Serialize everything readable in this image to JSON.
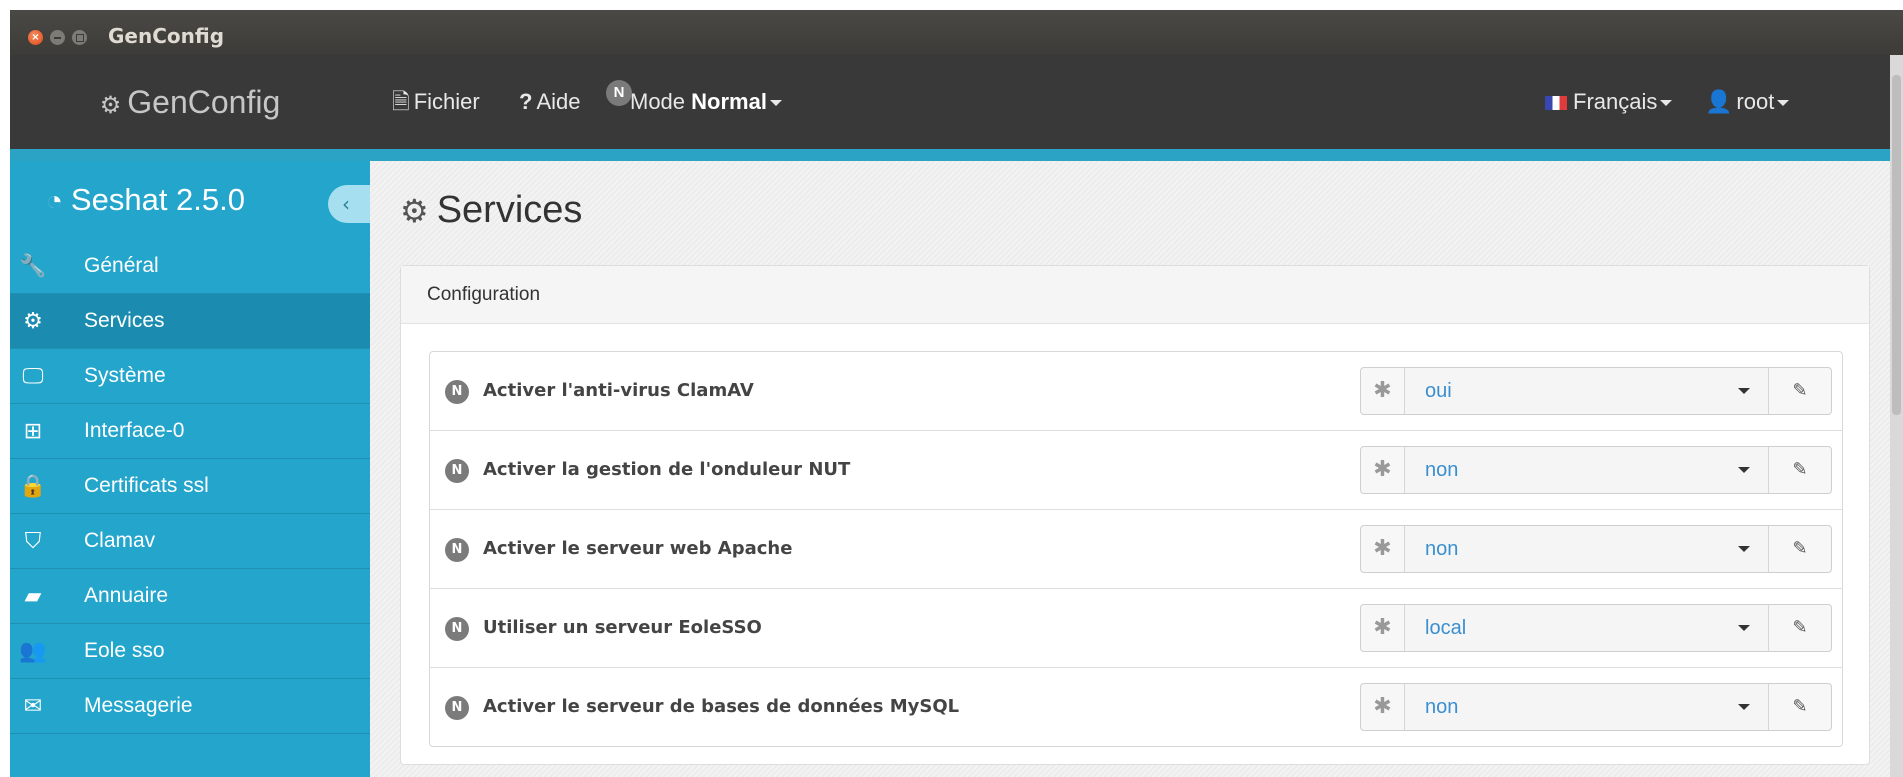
{
  "window": {
    "title": "GenConfig"
  },
  "navbar": {
    "brand": "GenConfig",
    "file_label": "Fichier",
    "help_label": "Aide",
    "mode_badge": "N",
    "mode_label": "Mode",
    "mode_value": "Normal",
    "language_label": "Français",
    "user_label": "root"
  },
  "sidebar": {
    "title": "Seshat 2.5.0",
    "collapse_glyph": "‹",
    "items": [
      {
        "label": "Général",
        "icon": "wrench-icon",
        "glyph": "🔧"
      },
      {
        "label": "Services",
        "icon": "gears-icon",
        "glyph": "⚙"
      },
      {
        "label": "Système",
        "icon": "desktop-icon",
        "glyph": "🖵"
      },
      {
        "label": "Interface-0",
        "icon": "sitemap-icon",
        "glyph": "⊞"
      },
      {
        "label": "Certificats ssl",
        "icon": "lock-icon",
        "glyph": "🔒"
      },
      {
        "label": "Clamav",
        "icon": "shield-icon",
        "glyph": "⛉"
      },
      {
        "label": "Annuaire",
        "icon": "book-icon",
        "glyph": "▰"
      },
      {
        "label": "Eole sso",
        "icon": "users-icon",
        "glyph": "👥"
      },
      {
        "label": "Messagerie",
        "icon": "envelope-icon",
        "glyph": "✉"
      }
    ],
    "active_index": 1
  },
  "main": {
    "page_title": "Services",
    "panel_heading": "Configuration",
    "rows": [
      {
        "badge": "N",
        "label": "Activer l'anti-virus ClamAV",
        "value": "oui"
      },
      {
        "badge": "N",
        "label": "Activer la gestion de l'onduleur NUT",
        "value": "non"
      },
      {
        "badge": "N",
        "label": "Activer le serveur web Apache",
        "value": "non"
      },
      {
        "badge": "N",
        "label": "Utiliser un serveur EoleSSO",
        "value": "local"
      },
      {
        "badge": "N",
        "label": "Activer le serveur de bases de données MySQL",
        "value": "non"
      }
    ]
  },
  "colors": {
    "sidebar_bg": "#24a5cc",
    "sidebar_active": "#1b8cb0",
    "navbar_bg": "#393939",
    "value_text": "#3a8fd0"
  }
}
